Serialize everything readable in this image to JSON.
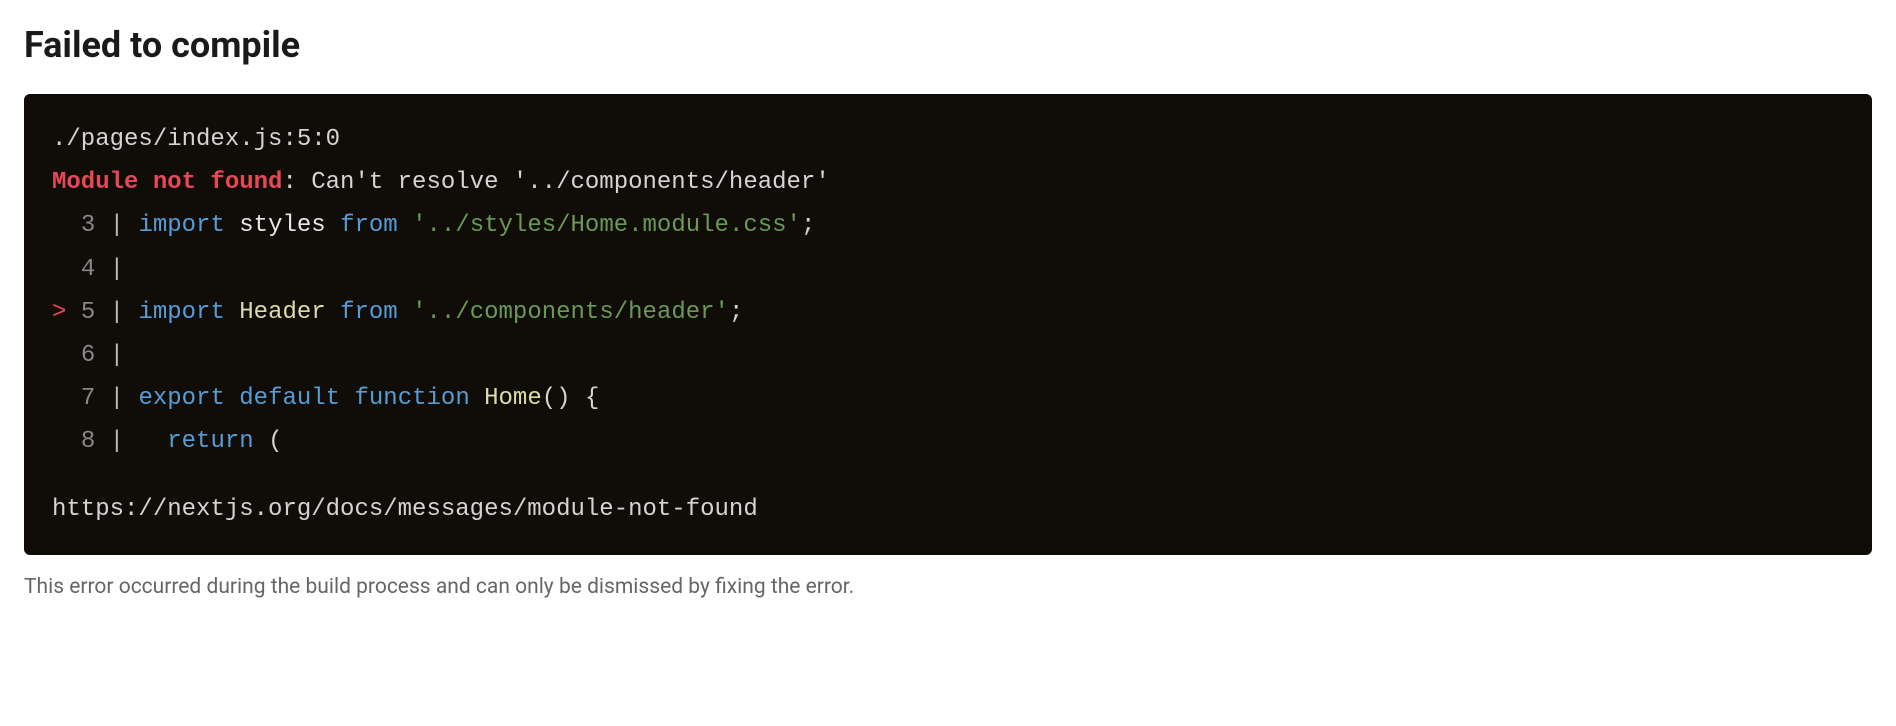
{
  "heading": "Failed to compile",
  "error": {
    "file_location": "./pages/index.js:5:0",
    "label": "Module not found",
    "message": ": Can't resolve '../components/header'"
  },
  "code": {
    "lines": [
      {
        "caret": "  ",
        "num": "3",
        "pipe": " | ",
        "tokens": {
          "kw": "import",
          "ident": " styles ",
          "from": "from",
          "sp": " ",
          "str": "'../styles/Home.module.css'",
          "punct": ";"
        }
      },
      {
        "caret": "  ",
        "num": "4",
        "pipe": " | ",
        "content": ""
      },
      {
        "caret": "> ",
        "num": "5",
        "pipe": " | ",
        "tokens": {
          "kw": "import",
          "sp1": " ",
          "ident": "Header",
          "sp2": " ",
          "from": "from",
          "sp3": " ",
          "str": "'../components/header'",
          "punct": ";"
        }
      },
      {
        "caret": "  ",
        "num": "6",
        "pipe": " | ",
        "content": ""
      },
      {
        "caret": "  ",
        "num": "7",
        "pipe": " | ",
        "tokens": {
          "kw1": "export",
          "sp1": " ",
          "kw2": "default",
          "sp2": " ",
          "kw3": "function",
          "sp3": " ",
          "fn": "Home",
          "punct": "() {"
        }
      },
      {
        "caret": "  ",
        "num": "8",
        "pipe": " | ",
        "tokens": {
          "indent": "  ",
          "kw": "return",
          "punct": " ("
        }
      }
    ],
    "doc_link": "https://nextjs.org/docs/messages/module-not-found"
  },
  "footer_note": "This error occurred during the build process and can only be dismissed by fixing the error."
}
